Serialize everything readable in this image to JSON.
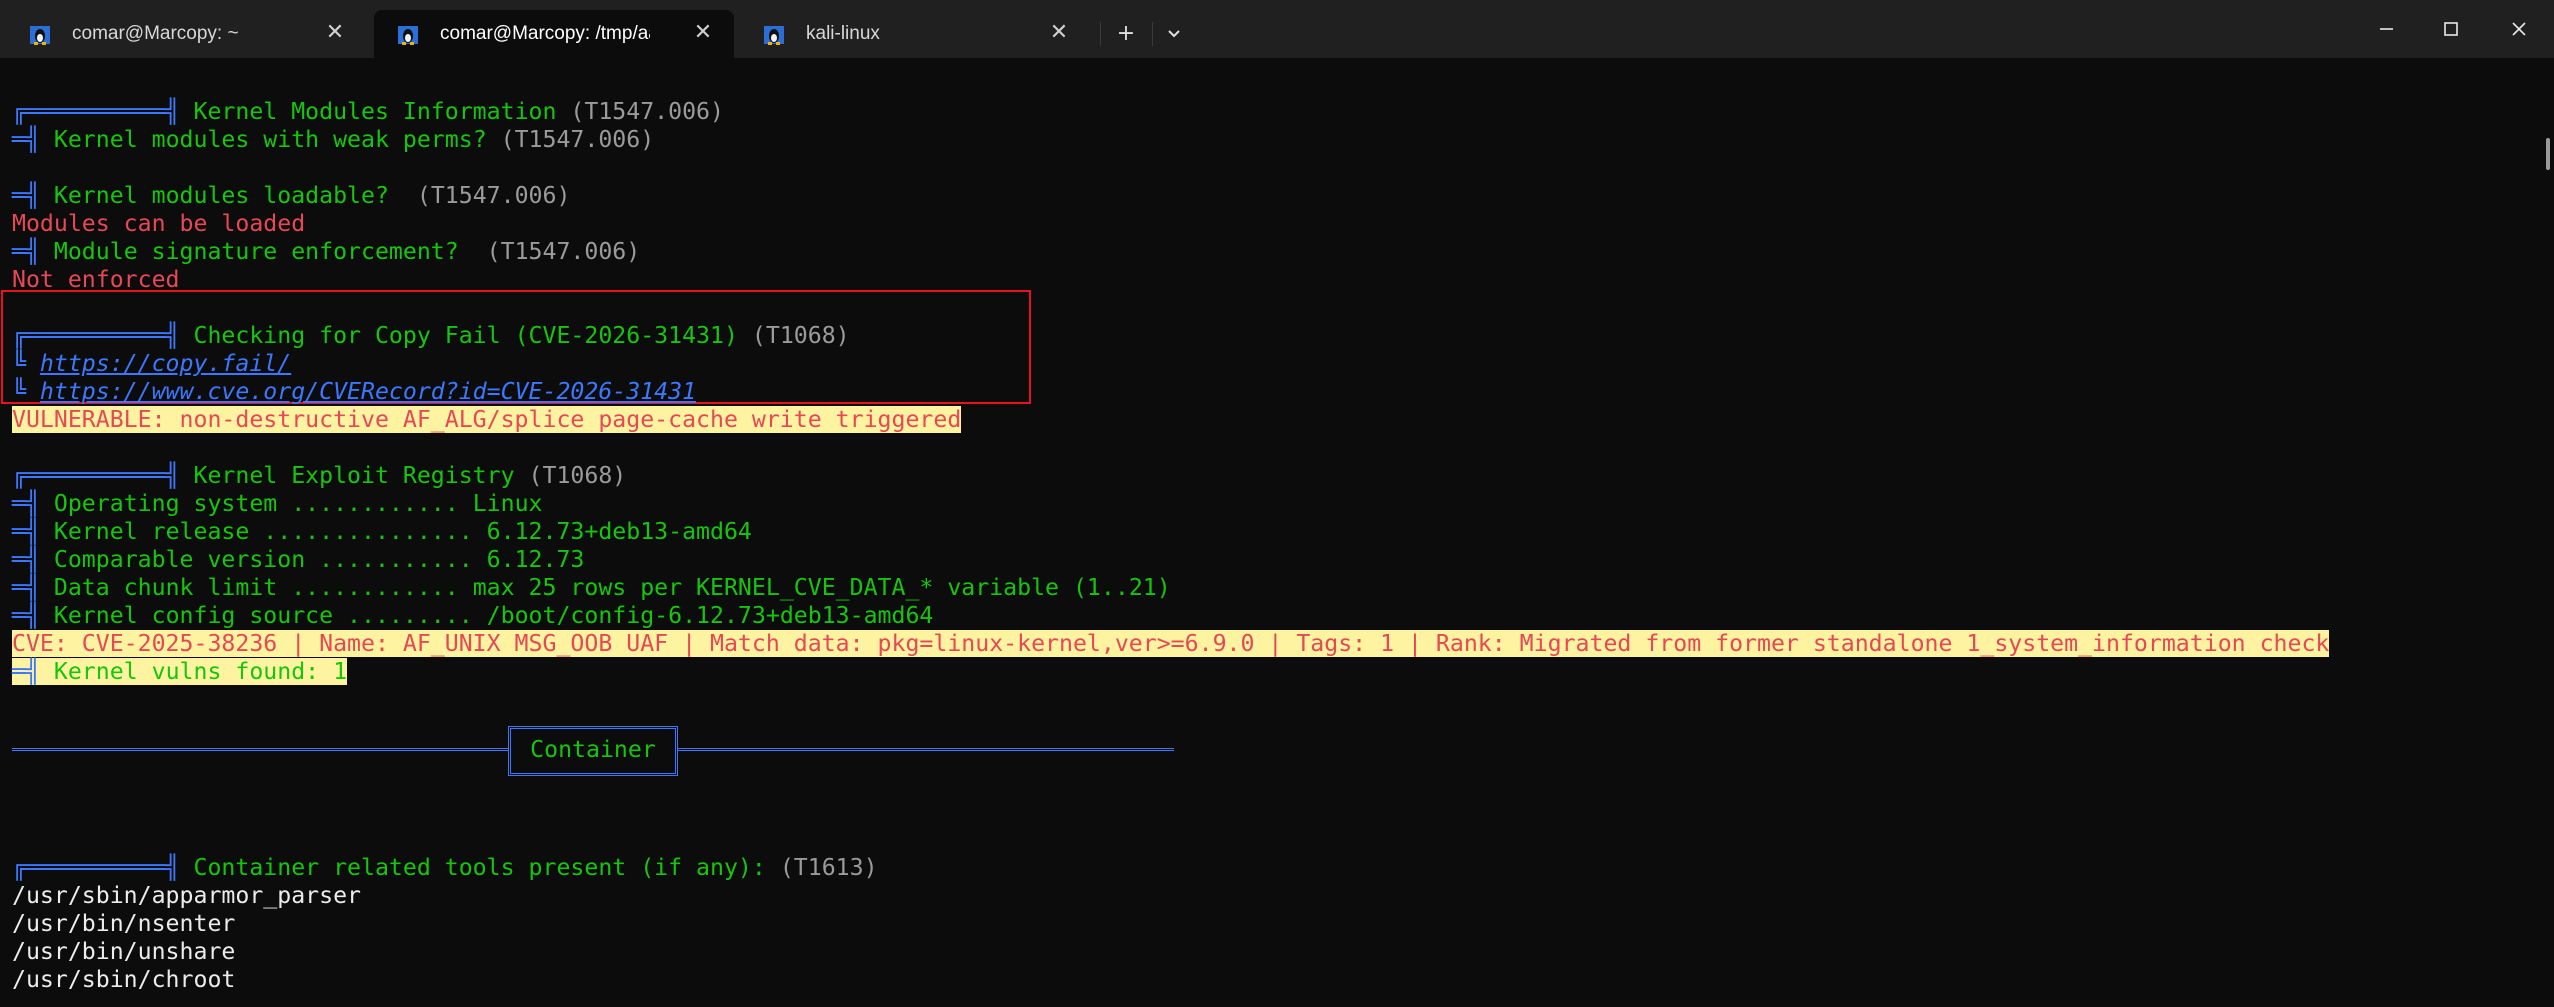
{
  "tabs": [
    {
      "title": "comar@Marcopy: ~",
      "active": false
    },
    {
      "title": "comar@Marcopy: /tmp/aaa/ll·",
      "active": true
    },
    {
      "title": "kali-linux",
      "active": false
    }
  ],
  "titlebar": {
    "new_tab": "+",
    "dropdown": "⌄",
    "minimize": "—",
    "maximize": "☐",
    "close": "✕"
  },
  "terminal": {
    "km_title": "Kernel Modules Information",
    "km_tag": "(T1547.006)",
    "weak_perms": "Kernel modules with weak perms?",
    "weak_perms_tag": "(T1547.006)",
    "loadable": "Kernel modules loadable?",
    "loadable_tag": " (T1547.006)",
    "loadable_result": "Modules can be loaded",
    "sig": "Module signature enforcement?",
    "sig_tag": " (T1547.006)",
    "sig_result": "Not enforced",
    "cf_title": "Checking for Copy Fail (CVE-2026-31431)",
    "cf_tag": "(T1068)",
    "link1": "https://copy.fail/",
    "link2": "https://www.cve.org/CVERecord?id=CVE-2026-31431",
    "vuln": "VULNERABLE: non-destructive AF_ALG/splice page-cache write triggered",
    "ker_title": "Kernel Exploit Registry",
    "ker_tag": "(T1068)",
    "kv": [
      "Operating system ............ Linux",
      "Kernel release ............... 6.12.73+deb13-amd64",
      "Comparable version ........... 6.12.73",
      "Data chunk limit ............ max 25 rows per KERNEL_CVE_DATA_* variable (1..21)",
      "Kernel config source ......... /boot/config-6.12.73+deb13-amd64"
    ],
    "cve_line": "CVE: CVE-2025-38236 | Name: AF_UNIX MSG_OOB UAF | Match data: pkg=linux-kernel,ver>=6.9.0 | Tags: 1 | Rank: Migrated from former standalone 1_system_information check",
    "vulns_found": "Kernel vulns found: 1",
    "container_section": "Container",
    "ct_title": "Container related tools present (if any):",
    "ct_tag": "(T1613)",
    "paths": [
      "/usr/sbin/apparmor_parser",
      "/usr/bin/nsenter",
      "/usr/bin/unshare",
      "/usr/sbin/chroot"
    ]
  },
  "colors": {
    "green": "#16c60c",
    "blue": "#3b78ff",
    "red": "#e74856",
    "highlight": "#fef3a0",
    "gray": "#9b9b9b"
  },
  "icons": [
    "linux-penguin-icon",
    "close-icon",
    "plus-icon",
    "chevron-down-icon",
    "minimize-icon",
    "maximize-icon",
    "window-close-icon"
  ]
}
